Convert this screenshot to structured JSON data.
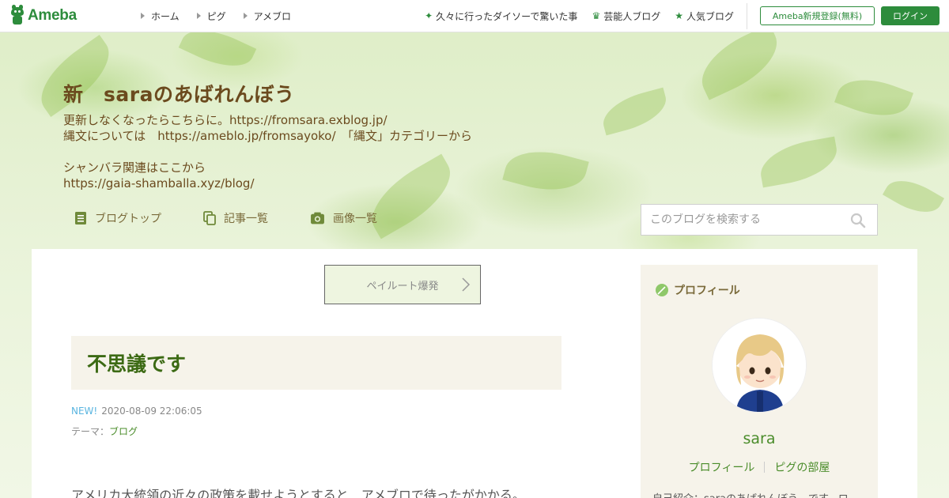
{
  "topbar": {
    "logo_text": "Ameba",
    "nav": [
      {
        "label": "ホーム"
      },
      {
        "label": "ピグ"
      },
      {
        "label": "アメブロ"
      }
    ],
    "links": [
      {
        "label": "久々に行ったダイソーで驚いた事",
        "icon": "sparkle-icon"
      },
      {
        "label": "芸能人ブログ",
        "icon": "crown-icon"
      },
      {
        "label": "人気ブログ",
        "icon": "star-icon"
      }
    ],
    "register_label": "Ameba新規登録(無料)",
    "login_label": "ログイン"
  },
  "header": {
    "title": "新　saraのあばれんぼう",
    "desc_lines": [
      "更新しなくなったらこちらに。https://fromsara.exblog.jp/",
      "縄文については　https://ameblo.jp/fromsayoko/　「縄文」カテゴリーから",
      "",
      "シャンバラ関連はここから",
      "https://gaia-shamballa.xyz/blog/"
    ],
    "nav": [
      {
        "label": "ブログトップ",
        "icon": "document-icon"
      },
      {
        "label": "記事一覧",
        "icon": "copy-icon"
      },
      {
        "label": "画像一覧",
        "icon": "camera-icon"
      }
    ],
    "search_placeholder": "このブログを検索する"
  },
  "main": {
    "ad_label": "ペイルート爆発",
    "entry": {
      "title": "不思議です",
      "new_badge": "NEW!",
      "datetime": "2020-08-09 22:06:05",
      "theme_label": "テーマ：",
      "theme_value": "ブログ",
      "body_first_line": "アメリカ大統領の近々の政策を載せようとすると　アメブロで待ったがかかる。"
    }
  },
  "sidebar": {
    "profile_heading": "プロフィール",
    "name": "sara",
    "link_profile": "プロフィール",
    "link_room": "ピグの部屋",
    "intro": "自己紹介：saraのあばれんぼう　です。ロ"
  },
  "colors": {
    "brand_green": "#2d8c3c",
    "title_brown": "#6b4a1e",
    "entry_title_green": "#3c6a14",
    "link_green": "#4a8c2a",
    "new_badge_blue": "#5ab5e0"
  }
}
